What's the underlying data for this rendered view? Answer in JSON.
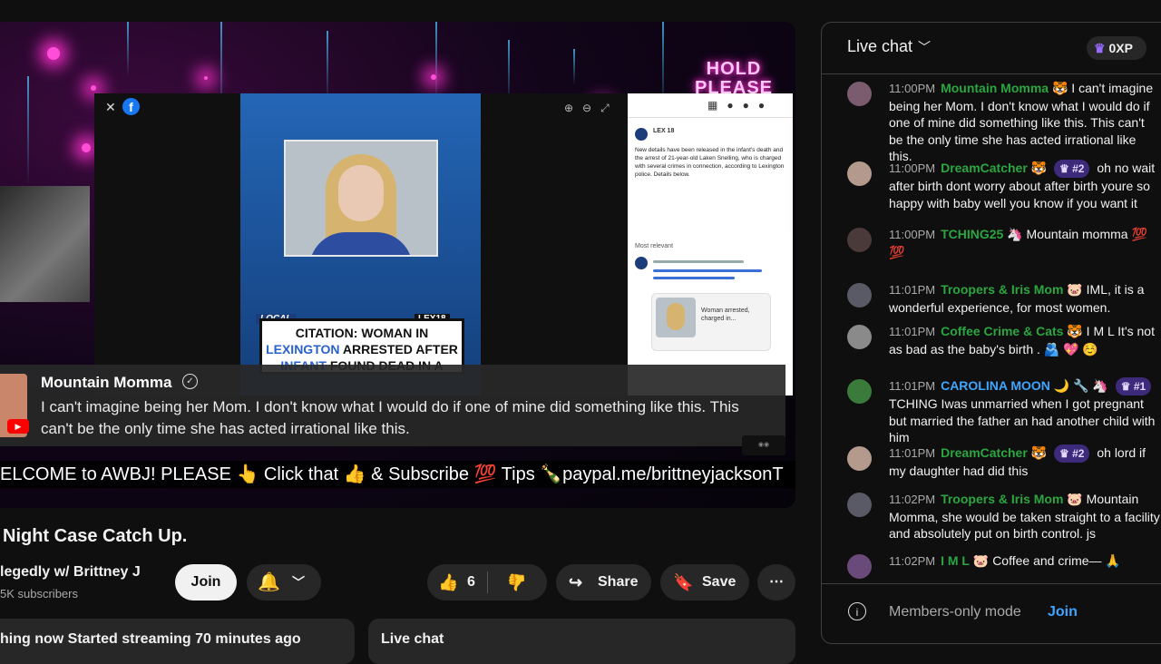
{
  "video": {
    "hold_please": [
      "HOLD",
      "PLEASE"
    ],
    "news": {
      "local_label": "LOCAL",
      "station_label": "LEX18",
      "headline_parts": [
        {
          "text": "CITATION: WOMAN IN ",
          "hl": false
        },
        {
          "text": "LEXINGTON",
          "hl": true
        },
        {
          "text": " ARRESTED AFTER ",
          "hl": false
        },
        {
          "text": "INFANT",
          "hl": true
        },
        {
          "text": " FOUND DEAD IN A CLOSET",
          "hl": false
        }
      ],
      "fb_post_author": "LEX 18",
      "fb_post_text": "New details have been released in the infant's death and the arrest of 21-year-old Laken Snelling, who is charged with several crimes in connection, according to Lexington police. Details below.",
      "fb_most_relevant": "Most relevant",
      "fb_card_title": "Woman arrested, charged in..."
    },
    "overlay": {
      "name": "Mountain Momma",
      "message": "I can't imagine being her Mom. I don't know what I would do if one of mine did something like this. This can't be the only time she has acted irrational like this."
    },
    "ticker": "ELCOME to AWBJ! PLEASE 👆 Click that 👍 & Subscribe 💯 Tips 🍾paypal.me/brittneyjacksonT"
  },
  "meta": {
    "title": "Night Case Catch Up.",
    "channel": "legedly w/ Brittney J",
    "subscribers": "5K subscribers",
    "join": "Join",
    "likes": "6",
    "share": "Share",
    "save": "Save",
    "more": "⋯"
  },
  "tabs": {
    "now_label": "hing now",
    "now_detail": "Started streaming 70 minutes ago",
    "chat_label": "Live chat"
  },
  "chat": {
    "header": "Live chat",
    "xp": "0XP",
    "messages": [
      {
        "time": "11:00PM",
        "name": "Mountain Momma",
        "emoji": "🐯",
        "badge": "",
        "text": "I can't imagine being her Mom. I don't know what I would do if one of mine did something like this. This can't be the only time she has acted irrational like this.",
        "avatar": "#7a5c6e"
      },
      {
        "time": "11:00PM",
        "name": "DreamCatcher",
        "emoji": "🐯",
        "badge": "#2",
        "text": "oh no wait after birth dont worry about after birth youre so happy with baby well you know if you want it",
        "avatar": "#b49a8c"
      },
      {
        "time": "11:00PM",
        "name": "TCHING25",
        "emoji": "🦄",
        "badge": "",
        "text": "Mountain momma 💯 💯",
        "avatar": "#4a3a3a"
      },
      {
        "time": "11:01PM",
        "name": "Troopers & Iris Mom",
        "emoji": "🐷",
        "badge": "",
        "text": "IML, it is a wonderful experience, for most women.",
        "avatar": "#5a5a66"
      },
      {
        "time": "11:01PM",
        "name": "Coffee Crime & Cats",
        "emoji": "🐯",
        "badge": "",
        "text": "I M L It's not as bad as the baby's birth . 🫂 💖 ☺️",
        "avatar": "#8a8a8a"
      },
      {
        "time": "11:01PM",
        "name": "CAROLINA MOON",
        "emoji": "🌙 🔧 🦄",
        "badge": "#1",
        "text": "TCHING Iwas unmarried when I got pregnant but married the father an had another child with him",
        "avatar": "#3a7a3a",
        "blue": true
      },
      {
        "time": "11:01PM",
        "name": "DreamCatcher",
        "emoji": "🐯",
        "badge": "#2",
        "text": "oh lord if my daughter had did this",
        "avatar": "#b49a8c"
      },
      {
        "time": "11:02PM",
        "name": "Troopers & Iris Mom",
        "emoji": "🐷",
        "badge": "",
        "text": "Mountain Momma, she would be taken straight to a facility and absolutely put on birth control. js",
        "avatar": "#5a5a66"
      },
      {
        "time": "11:02PM",
        "name": "I M L",
        "emoji": "🐷",
        "badge": "",
        "text": "Coffee and crime— 🙏",
        "avatar": "#6a4a7a"
      }
    ],
    "members_mode": "Members-only mode",
    "members_join": "Join"
  }
}
